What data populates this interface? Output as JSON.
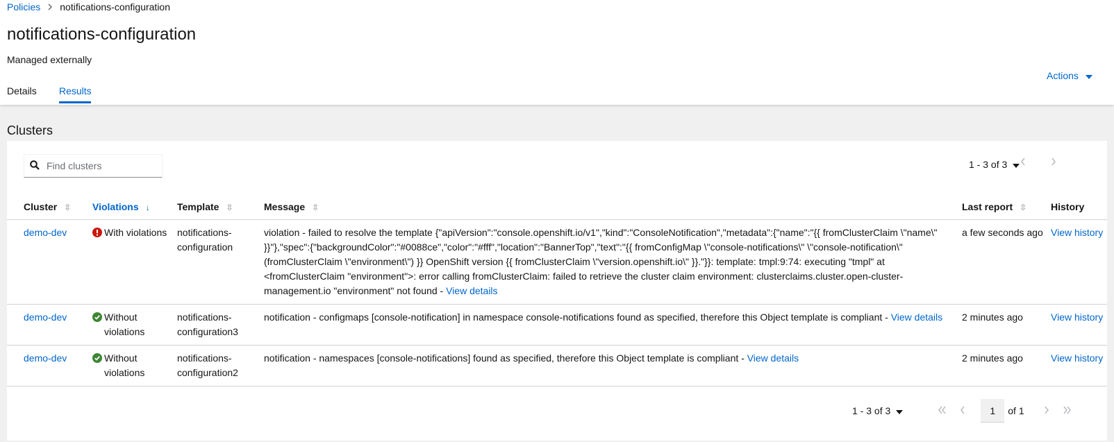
{
  "breadcrumb": {
    "root": "Policies",
    "current": "notifications-configuration"
  },
  "header": {
    "title": "notifications-configuration",
    "subtitle": "Managed externally",
    "actions_label": "Actions"
  },
  "tabs": [
    {
      "label": "Details",
      "active": false
    },
    {
      "label": "Results",
      "active": true
    }
  ],
  "section": {
    "title": "Clusters"
  },
  "search": {
    "placeholder": "Find clusters"
  },
  "pagination": {
    "range": "1 - 3 of 3",
    "page": "1",
    "of": "of 1"
  },
  "table": {
    "columns": [
      "Cluster",
      "Violations",
      "Template",
      "Message",
      "Last report",
      "History"
    ],
    "sorted_column": "Violations",
    "rows": [
      {
        "cluster": "demo-dev",
        "status_label": "With violations",
        "status": "violation",
        "template": "notifications-configuration",
        "message": "violation - failed to resolve the template {\"apiVersion\":\"console.openshift.io/v1\",\"kind\":\"ConsoleNotification\",\"metadata\":{\"name\":\"{{ fromClusterClaim \\\"name\\\" }}\"},\"spec\":{\"backgroundColor\":\"#0088ce\",\"color\":\"#fff\",\"location\":\"BannerTop\",\"text\":\"{{ fromConfigMap \\\"console-notifications\\\" \\\"console-notification\\\" (fromClusterClaim \\\"environment\\\") }} OpenShift version {{ fromClusterClaim \\\"version.openshift.io\\\" }}.\"}}: template: tmpl:9:74: executing \"tmpl\" at <fromClusterClaim \"environment\">: error calling fromClusterClaim: failed to retrieve the cluster claim environment: clusterclaims.cluster.open-cluster-management.io \"environment\" not found - ",
        "details_link": "View details",
        "last_report": "a few seconds ago",
        "history_link": "View history"
      },
      {
        "cluster": "demo-dev",
        "status_label": "Without violations",
        "status": "compliant",
        "template": "notifications-configuration3",
        "message": "notification - configmaps [console-notification] in namespace console-notifications found as specified, therefore this Object template is compliant - ",
        "details_link": "View details",
        "last_report": "2 minutes ago",
        "history_link": "View history"
      },
      {
        "cluster": "demo-dev",
        "status_label": "Without violations",
        "status": "compliant",
        "template": "notifications-configuration2",
        "message": "notification - namespaces [console-notifications] found as specified, therefore this Object template is compliant - ",
        "details_link": "View details",
        "last_report": "2 minutes ago",
        "history_link": "View history"
      }
    ]
  },
  "colors": {
    "link": "#0066cc",
    "danger": "#c9190b",
    "success": "#3e8635"
  },
  "icons": {
    "violation": "exclamation-circle-icon",
    "compliant": "check-circle-icon",
    "search": "search-icon"
  }
}
